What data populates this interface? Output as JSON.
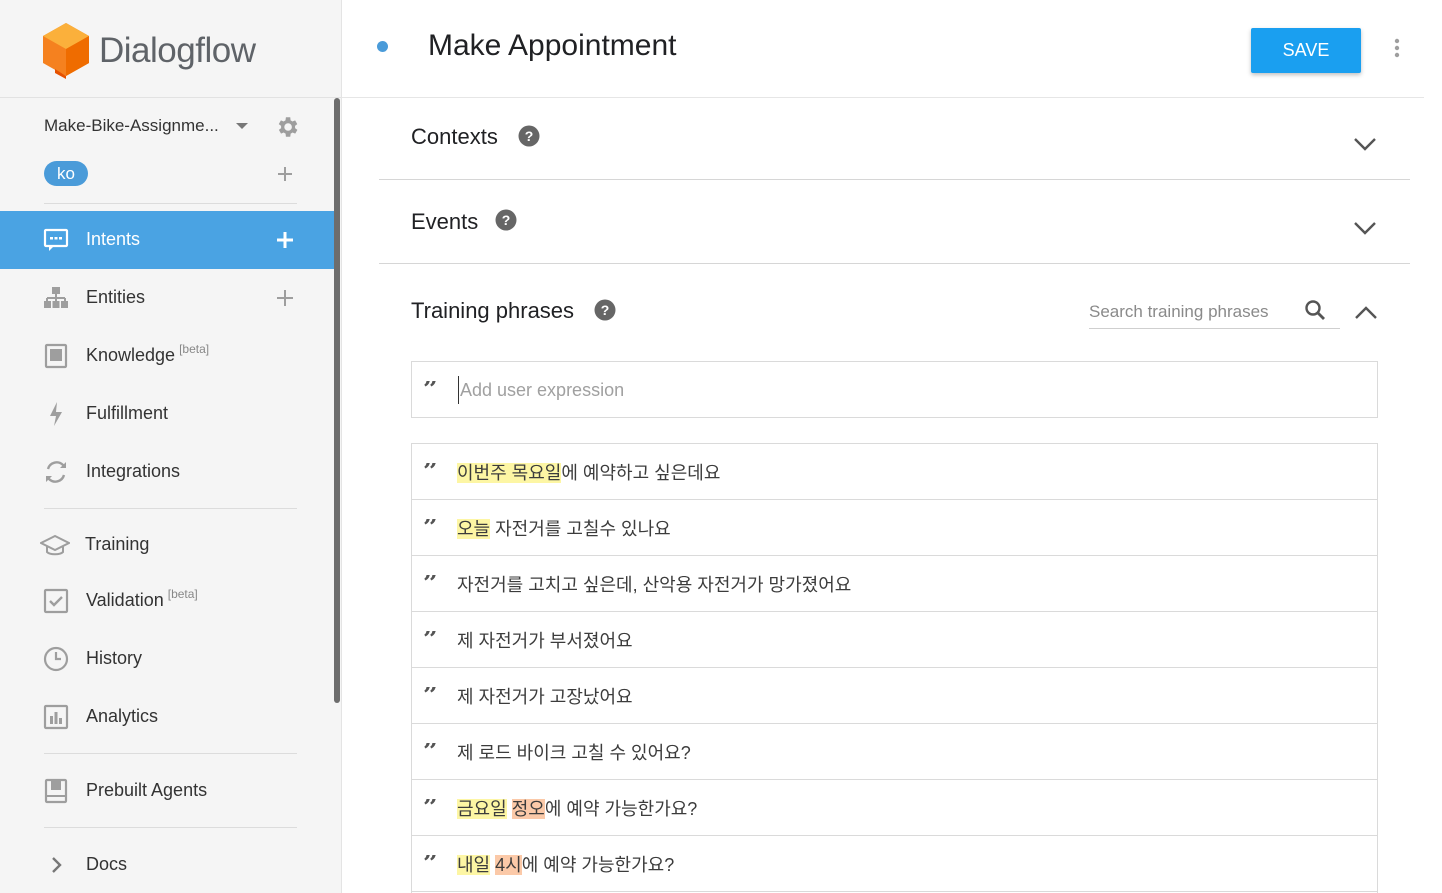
{
  "brand": {
    "name": "Dialogflow"
  },
  "agent": {
    "name": "Make-Bike-Assignme...",
    "language": "ko"
  },
  "nav": {
    "intents": "Intents",
    "entities": "Entities",
    "knowledge": "Knowledge",
    "knowledge_badge": "[beta]",
    "fulfillment": "Fulfillment",
    "integrations": "Integrations",
    "training": "Training",
    "validation": "Validation",
    "validation_badge": "[beta]",
    "history": "History",
    "analytics": "Analytics",
    "prebuilt_agents": "Prebuilt Agents",
    "docs": "Docs"
  },
  "header": {
    "title": "Make Appointment",
    "save_label": "SAVE"
  },
  "sections": {
    "contexts": "Contexts",
    "events": "Events",
    "training_phrases": "Training phrases"
  },
  "search": {
    "placeholder": "Search training phrases"
  },
  "add_expression": {
    "placeholder": "Add user expression"
  },
  "phrases": [
    {
      "segments": [
        {
          "text": "이번주 목요일",
          "hl": "yellow"
        },
        {
          "text": "에 예약하고 싶은데요",
          "hl": ""
        }
      ]
    },
    {
      "segments": [
        {
          "text": "오늘",
          "hl": "yellow"
        },
        {
          "text": " 자전거를 고칠수 있나요",
          "hl": ""
        }
      ]
    },
    {
      "segments": [
        {
          "text": "자전거를 고치고 싶은데, 산악용 자전거가 망가졌어요",
          "hl": ""
        }
      ]
    },
    {
      "segments": [
        {
          "text": "제 자전거가 부서졌어요",
          "hl": ""
        }
      ]
    },
    {
      "segments": [
        {
          "text": "제 자전거가 고장났어요",
          "hl": ""
        }
      ]
    },
    {
      "segments": [
        {
          "text": "제 로드 바이크 고칠 수 있어요?",
          "hl": ""
        }
      ]
    },
    {
      "segments": [
        {
          "text": "금요일",
          "hl": "yellow"
        },
        {
          "text": " ",
          "hl": ""
        },
        {
          "text": "정오",
          "hl": "orange"
        },
        {
          "text": "에 예약 가능한가요?",
          "hl": ""
        }
      ]
    },
    {
      "segments": [
        {
          "text": "내일",
          "hl": "yellow"
        },
        {
          "text": " ",
          "hl": ""
        },
        {
          "text": "4시",
          "hl": "orange"
        },
        {
          "text": "에 예약 가능한가요?",
          "hl": ""
        }
      ]
    }
  ],
  "colors": {
    "accent": "#4aa3e3",
    "save": "#1a9ff0",
    "highlight_date": "#fdf6a4",
    "highlight_time": "#fbc9a8",
    "logo": "#f5811f"
  }
}
